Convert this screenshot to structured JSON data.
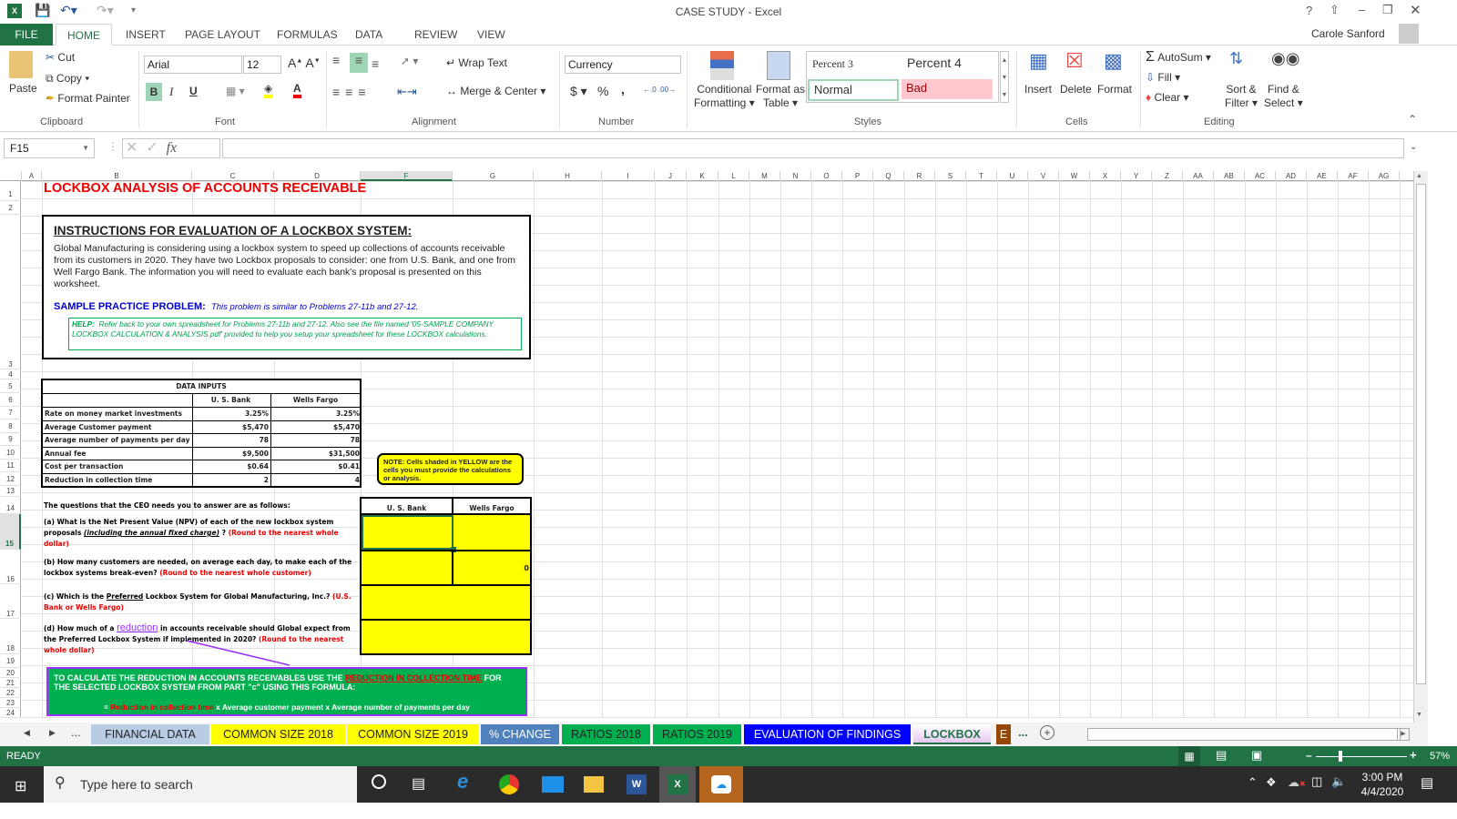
{
  "window": {
    "title": "CASE STUDY - Excel",
    "user": "Carole Sanford",
    "help": "?"
  },
  "ribbon_tabs": [
    "FILE",
    "HOME",
    "INSERT",
    "PAGE LAYOUT",
    "FORMULAS",
    "DATA",
    "REVIEW",
    "VIEW"
  ],
  "clipboard": {
    "paste": "Paste",
    "cut": "Cut",
    "copy": "Copy",
    "format_painter": "Format Painter",
    "label": "Clipboard"
  },
  "font": {
    "name": "Arial",
    "size": "12",
    "label": "Font",
    "bold": "B",
    "italic": "I",
    "underline": "U"
  },
  "alignment": {
    "wrap": "Wrap Text",
    "merge": "Merge & Center",
    "label": "Alignment"
  },
  "number": {
    "format": "Currency",
    "dollar": "$",
    "percent": "%",
    "comma": ",",
    "label": "Number"
  },
  "styles": {
    "conditional": "Conditional",
    "conditional2": "Formatting",
    "format_table": "Format as",
    "format_table2": "Table",
    "percent3": "Percent 3",
    "percent4": "Percent 4",
    "normal": "Normal",
    "bad": "Bad",
    "label": "Styles"
  },
  "cells": {
    "insert": "Insert",
    "delete": "Delete",
    "format": "Format",
    "label": "Cells"
  },
  "editing": {
    "autosum": "AutoSum",
    "fill": "Fill",
    "clear": "Clear",
    "sort": "Sort &",
    "sort2": "Filter",
    "find": "Find &",
    "find2": "Select",
    "label": "Editing"
  },
  "formula_bar": {
    "name_box": "F15",
    "fx": "fx",
    "value": ""
  },
  "columns": [
    "A",
    "B",
    "C",
    "D",
    "F",
    "G",
    "H",
    "I",
    "J",
    "K",
    "L",
    "M",
    "N",
    "O",
    "P",
    "Q",
    "R",
    "S",
    "T",
    "U",
    "V",
    "W",
    "X",
    "Y",
    "Z",
    "AA",
    "AB",
    "AC",
    "AD",
    "AE",
    "AF",
    "AG"
  ],
  "rows": [
    "1",
    "2",
    "3",
    "4",
    "5",
    "6",
    "7",
    "8",
    "9",
    "10",
    "11",
    "12",
    "13",
    "14",
    "15",
    "16",
    "17",
    "18",
    "19",
    "20",
    "21",
    "22",
    "23",
    "24"
  ],
  "sheet": {
    "title": "LOCKBOX ANALYSIS OF ACCOUNTS RECEIVABLE",
    "instructions": {
      "heading": "INSTRUCTIONS FOR EVALUATION OF A LOCKBOX SYSTEM:",
      "body": "Global Manufacturing is considering using a lockbox system to speed up collections of accounts receivable from its customers in 2020.  They have two Lockbox proposals to consider: one from U.S. Bank, and one from Well Fargo Bank. The information you will need to evaluate each bank's proposal is presented on this worksheet.",
      "sample_label": "SAMPLE PRACTICE PROBLEM:",
      "sample_text": "This problem is similar to Problems 27-11b and 27-12.",
      "help_label": "HELP:",
      "help_text": "Refer back to your own spreadsheet for Problems 27-11b and 27-12.  Also see the file named '05-SAMPLE COMPANY LOCKBOX CALCULATION & ANALYSIS.pdf' provided to help you setup your spreadsheet for these LOCKBOX calculations."
    },
    "data_inputs": {
      "title": "DATA INPUTS",
      "headers": [
        "U. S. Bank",
        "Wells Fargo"
      ],
      "rows": [
        {
          "label": "Rate on money market investments",
          "us": "3.25%",
          "wf": "3.25%"
        },
        {
          "label": "Average Customer payment",
          "us": "$5,470",
          "wf": "$5,470"
        },
        {
          "label": "Average number of payments per day",
          "us": "78",
          "wf": "78"
        },
        {
          "label": "Annual fee",
          "us": "$9,500",
          "wf": "$31,500"
        },
        {
          "label": "Cost per transaction",
          "us": "$0.64",
          "wf": "$0.41"
        },
        {
          "label": "Reduction in collection time",
          "us": "2",
          "wf": "4"
        }
      ]
    },
    "note": "NOTE:  Cells shaded in YELLOW are the cells you must provide the calculations or analysis.",
    "questions_intro": "The questions that the CEO needs you to answer are as follows:",
    "q_a": {
      "text": "(a) What is the Net Present Value (NPV) of each of the new lockbox system proposals ",
      "italic": "(including the annual fixed charge)",
      "q": " ? ",
      "red": "(Round to the nearest whole dollar)"
    },
    "q_b": {
      "text": "(b) How many customers are needed, on average each day, to make each of the  lockbox systems break-even? ",
      "red": "(Round to the nearest whole customer)"
    },
    "q_c": {
      "text1": "(c) Which is the ",
      "underline": "Preferred",
      "text2": " Lockbox System for Global Manufacturing, Inc.? ",
      "red": "(U.S. Bank or Wells Fargo)"
    },
    "q_d": {
      "text1": "(d) How much of a ",
      "link": "reduction",
      "text2": " in accounts receivable should Global expect from the Preferred Lockbox System if implemented in 2020?   ",
      "red": "(Round to the nearest whole dollar)"
    },
    "answers": {
      "headers": [
        "U. S. Bank",
        "Wells Fargo"
      ],
      "b_wf": "0"
    },
    "formula_box": {
      "line1a": "TO CALCULATE THE REDUCTION IN ACCOUNTS RECEIVABLES USE THE ",
      "line1red": "REDUCTION IN COLLECTION TIME",
      "line1b": " FOR THE SELECTED LOCKBOX SYSTEM FROM PART \"c\" USING THIS FORMULA:",
      "eq": "= ",
      "eqred": "Reduction in collection time",
      "eqrest": " x Average customer payment x Average number of payments per day"
    }
  },
  "sheet_tabs": [
    {
      "label": "FINANCIAL DATA",
      "bg": "#b8cce4",
      "fg": "#222"
    },
    {
      "label": "COMMON SIZE 2018",
      "bg": "#ffff00",
      "fg": "#222"
    },
    {
      "label": "COMMON SIZE 2019",
      "bg": "#ffff00",
      "fg": "#222"
    },
    {
      "label": "% CHANGE",
      "bg": "#4f81bd",
      "fg": "#fff"
    },
    {
      "label": "RATIOS 2018",
      "bg": "#00b050",
      "fg": "#222"
    },
    {
      "label": "RATIOS 2019",
      "bg": "#00b050",
      "fg": "#222"
    },
    {
      "label": "EVALUATION OF FINDINGS",
      "bg": "#0000ff",
      "fg": "#fff"
    },
    {
      "label": "LOCKBOX",
      "bg": "#e6c8f0",
      "fg": "#217346",
      "active": true
    },
    {
      "label": "E",
      "bg": "#974706",
      "fg": "#fff"
    }
  ],
  "sheet_nav": {
    "more": "...",
    "add": "+"
  },
  "status": {
    "mode": "READY",
    "zoom": "57%"
  },
  "taskbar": {
    "search_placeholder": "Type here to search",
    "time": "3:00 PM",
    "date": "4/4/2020"
  }
}
